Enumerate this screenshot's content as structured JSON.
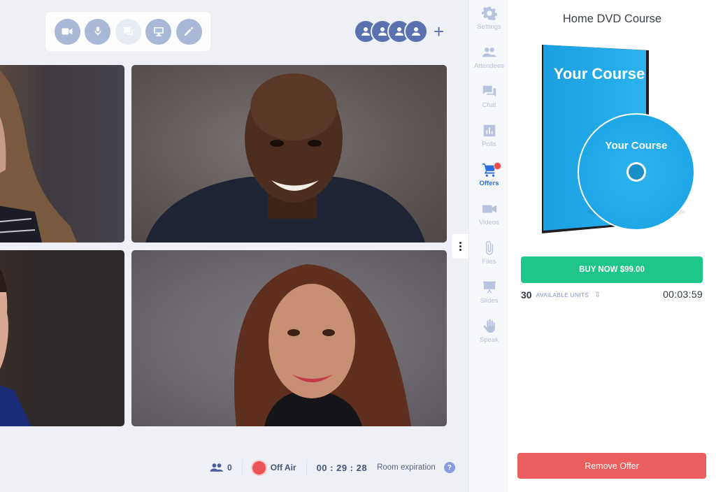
{
  "toolbar": {
    "buttons": [
      {
        "name": "camera",
        "icon": "video-camera-icon",
        "enabled": true
      },
      {
        "name": "microphone",
        "icon": "microphone-icon",
        "enabled": true
      },
      {
        "name": "chat-bubble",
        "icon": "chat-bubble-icon",
        "enabled": false
      },
      {
        "name": "screen-share",
        "icon": "monitor-icon",
        "enabled": true
      },
      {
        "name": "draw",
        "icon": "pencil-icon",
        "enabled": true
      }
    ]
  },
  "participants": {
    "avatar_count": 4,
    "add_label": "+"
  },
  "video_tiles": [
    {
      "id": "tile-1",
      "description": "woman with long brown hair (partially visible)"
    },
    {
      "id": "tile-2",
      "description": "smiling bald man in dark shirt"
    },
    {
      "id": "tile-3",
      "description": "man in blue shirt (partially visible)"
    },
    {
      "id": "tile-4",
      "description": "smiling woman with long auburn hair"
    }
  ],
  "status_bar": {
    "attendee_count": "0",
    "air_status": "Off Air",
    "timer": "00 : 29 : 28",
    "expiration_label": "Room expiration",
    "help_label": "?"
  },
  "rail": {
    "items": [
      {
        "label": "Settings",
        "icon": "gear-icon",
        "active": false
      },
      {
        "label": "Attendees",
        "icon": "people-icon",
        "active": false
      },
      {
        "label": "Chat",
        "icon": "chat-icon",
        "active": false
      },
      {
        "label": "Polls",
        "icon": "bar-chart-icon",
        "active": false
      },
      {
        "label": "Offers",
        "icon": "cart-icon",
        "active": true,
        "badge": true
      },
      {
        "label": "Videos",
        "icon": "video-camera-icon",
        "active": false
      },
      {
        "label": "Files",
        "icon": "paperclip-icon",
        "active": false
      },
      {
        "label": "Slides",
        "icon": "presentation-icon",
        "active": false
      },
      {
        "label": "Speak",
        "icon": "raised-hand-icon",
        "active": false
      }
    ]
  },
  "offer": {
    "title": "Home DVD Course",
    "product_case_text": "Your Course",
    "product_disc_text": "Your Course",
    "buy_label": "BUY NOW $99.00",
    "units_count": "30",
    "units_label": "AVAILABLE UNITS",
    "countdown": "00:03:59",
    "remove_label": "Remove Offer"
  },
  "colors": {
    "accent": "#2a6de0",
    "buy": "#1fc68a",
    "remove": "#ea5e5e",
    "off_air": "#ea5455",
    "avatar": "#5a72b0",
    "product_blue": "#22a8e8"
  }
}
